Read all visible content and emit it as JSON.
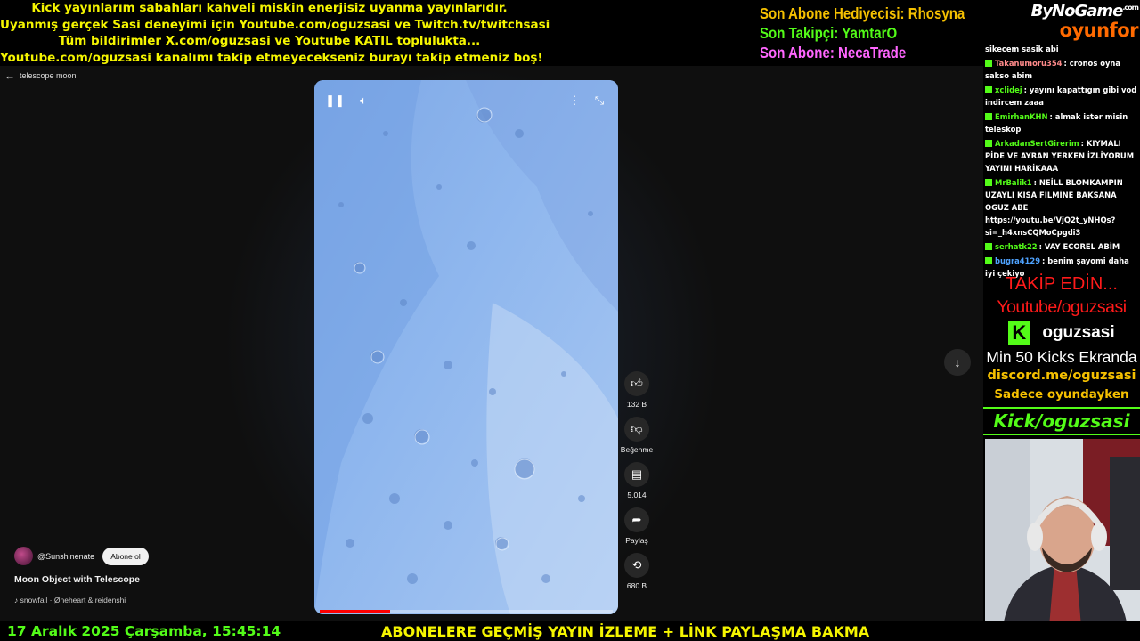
{
  "banner": {
    "lines": [
      "Kick yayınlarım sabahları kahveli miskin enerjisiz uyanma yayınlarıdır.",
      "Uyanmış gerçek Sasi deneyimi için Youtube.com/oguzsasi ve Twitch.tv/twitchsasi",
      "Tüm bildirimler X.com/oguzsasi ve Youtube KATIL topluluktа...",
      "Youtube.com/oguzsasi kanalımı takip etmeyecekseniz burayı takip etmeniz boş!"
    ]
  },
  "subs": {
    "gift": "Son Abone Hediyecisi: Rhosyna",
    "follower": "Son Takipçi: YamtarO",
    "sub": "Son Abone: NecaTrade",
    "colors": {
      "gift": "#f5c000",
      "follower": "#53fc18",
      "sub": "#ff66ff"
    }
  },
  "logo": {
    "line1": "ByNoGame",
    "com": ".com",
    "line2": "oyunfor"
  },
  "youtube": {
    "back_label": "telescope moon",
    "likes": "132 B",
    "dislike": "Beğenme",
    "comments": "5.014",
    "share": "Paylaş",
    "remix": "680 B",
    "channel": "@Sunshinenate",
    "subscribe": "Abone ol",
    "title": "Moon Object with Telescope",
    "music": "♪ snowfall · Øneheart & reidenshi",
    "progress": 0.24
  },
  "chat": [
    {
      "user": "",
      "text": "sikecem sasik abi",
      "color": "#ffffff",
      "badge": false
    },
    {
      "user": "Takanumoru354",
      "text": ": cronos oyna sakso abim",
      "color": "#ff8a8a",
      "badge": true
    },
    {
      "user": "xclidej",
      "text": ": yayını kapattıgın gibi vod indircem zaaa",
      "color": "#53fc18",
      "badge": true
    },
    {
      "user": "EmirhanKHN",
      "text": ": almak ister misin teleskop",
      "color": "#53fc18",
      "badge": true
    },
    {
      "user": "ArkadanSertGirerim",
      "text": ": KIYMALI PİDE VE AYRAN YERKEN İZLİYORUM YAYINI HARİKAAA",
      "color": "#53fc18",
      "badge": true
    },
    {
      "user": "MrBalik1",
      "text": ": NEİLL BLOMKAMPIN UZAYLI KISA FİLMİNE BAKSANA OGUZ ABE https://youtu.be/VjQ2t_yNHQs?si=_h4xnsCQMoCpgdi3",
      "color": "#53fc18",
      "badge": true
    },
    {
      "user": "serhatk22",
      "text": ": VAY ECOREL ABİM",
      "color": "#53fc18",
      "badge": true
    },
    {
      "user": "bugra4129",
      "text": ": benim şayomi daha iyi çekiyo",
      "color": "#4fa3ff",
      "badge": true
    }
  ],
  "promo": {
    "follow": "TAKİP EDİN...",
    "youtube": "Youtube/oguzsasi",
    "kick_name": "oguzsasi",
    "kicks": "Min 50 Kicks Ekranda",
    "discord": "discord.me/oguzsasi",
    "only_game": "Sadece oyundayken",
    "kick_url": "Kick/oguzsasi"
  },
  "bottom": {
    "datetime": "17 Aralık 2025 Çarşamba, 15:45:14",
    "ticker": "ABONELERE GEÇMİŞ YAYIN İZLEME + LİNK PAYLAŞMA BAKMA"
  }
}
